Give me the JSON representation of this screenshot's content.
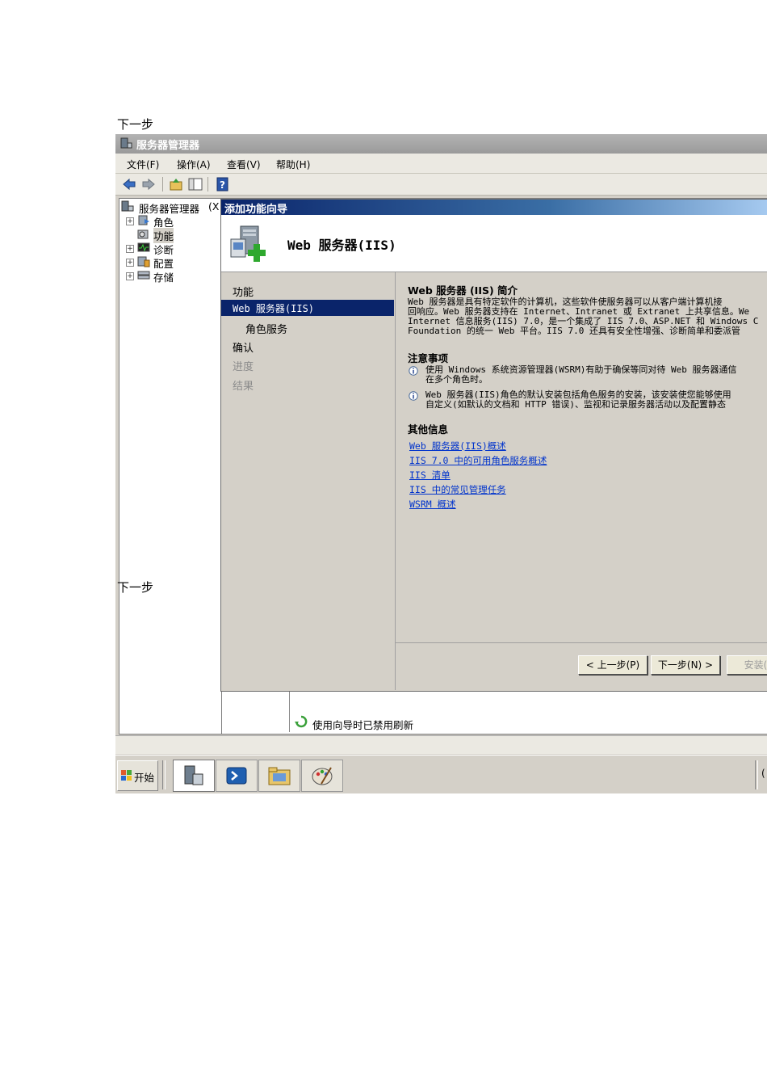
{
  "doc": {
    "label_top": "下一步",
    "label_mid": "下一步"
  },
  "window": {
    "title": "服务器管理器"
  },
  "menu": [
    "文件(F)",
    "操作(A)",
    "查看(V)",
    "帮助(H)"
  ],
  "toolbar": {
    "icons": [
      "back-arrow-icon",
      "forward-arrow-icon",
      "up-folder-icon",
      "show-hide-tree-icon",
      "help-icon"
    ]
  },
  "tree": {
    "root": "服务器管理器",
    "root_suffix": "(X",
    "items": [
      {
        "label": "角色",
        "expander": "+"
      },
      {
        "label": "功能",
        "expander": ""
      },
      {
        "label": "诊断",
        "expander": "+"
      },
      {
        "label": "配置",
        "expander": "+"
      },
      {
        "label": "存储",
        "expander": "+"
      }
    ]
  },
  "wizard": {
    "title": "添加功能向导",
    "header": "Web 服务器(IIS)",
    "nav": [
      {
        "label": "功能",
        "state": "normal"
      },
      {
        "label": "Web 服务器(IIS)",
        "state": "selected"
      },
      {
        "label": "角色服务",
        "state": "sub"
      },
      {
        "label": "确认",
        "state": "normal"
      },
      {
        "label": "进度",
        "state": "disabled"
      },
      {
        "label": "结果",
        "state": "disabled"
      }
    ],
    "intro_heading": "Web 服务器 (IIS) 简介",
    "intro_lines": [
      "Web 服务器是具有特定软件的计算机，这些软件使服务器可以从客户端计算机接",
      "回响应。Web 服务器支持在 Internet、Intranet 或 Extranet 上共享信息。We",
      "Internet 信息服务(IIS) 7.0，是一个集成了 IIS 7.0、ASP.NET 和 Windows C",
      "Foundation 的统一 Web 平台。IIS 7.0 还具有安全性增强、诊断简单和委派管"
    ],
    "notes_heading": "注意事项",
    "note1_lines": [
      "使用 Windows 系统资源管理器(WSRM)有助于确保等同对待 Web 服务器通信",
      "在多个角色时。"
    ],
    "note2_lines": [
      "Web 服务器(IIS)角色的默认安装包括角色服务的安装，该安装使您能够使用",
      "自定义(如默认的文档和 HTTP 错误)、监视和记录服务器活动以及配置静态"
    ],
    "more_heading": "其他信息",
    "links": [
      "Web 服务器(IIS)概述",
      "IIS 7.0 中的可用角色服务概述",
      "IIS 清单",
      "IIS 中的常见管理任务",
      "WSRM 概述"
    ],
    "buttons": {
      "prev": "< 上一步(P)",
      "next": "下一步(N) >",
      "install": "安装("
    }
  },
  "status": {
    "message": "使用向导时已禁用刷新"
  },
  "taskbar": {
    "start": "开始",
    "tray": "("
  }
}
